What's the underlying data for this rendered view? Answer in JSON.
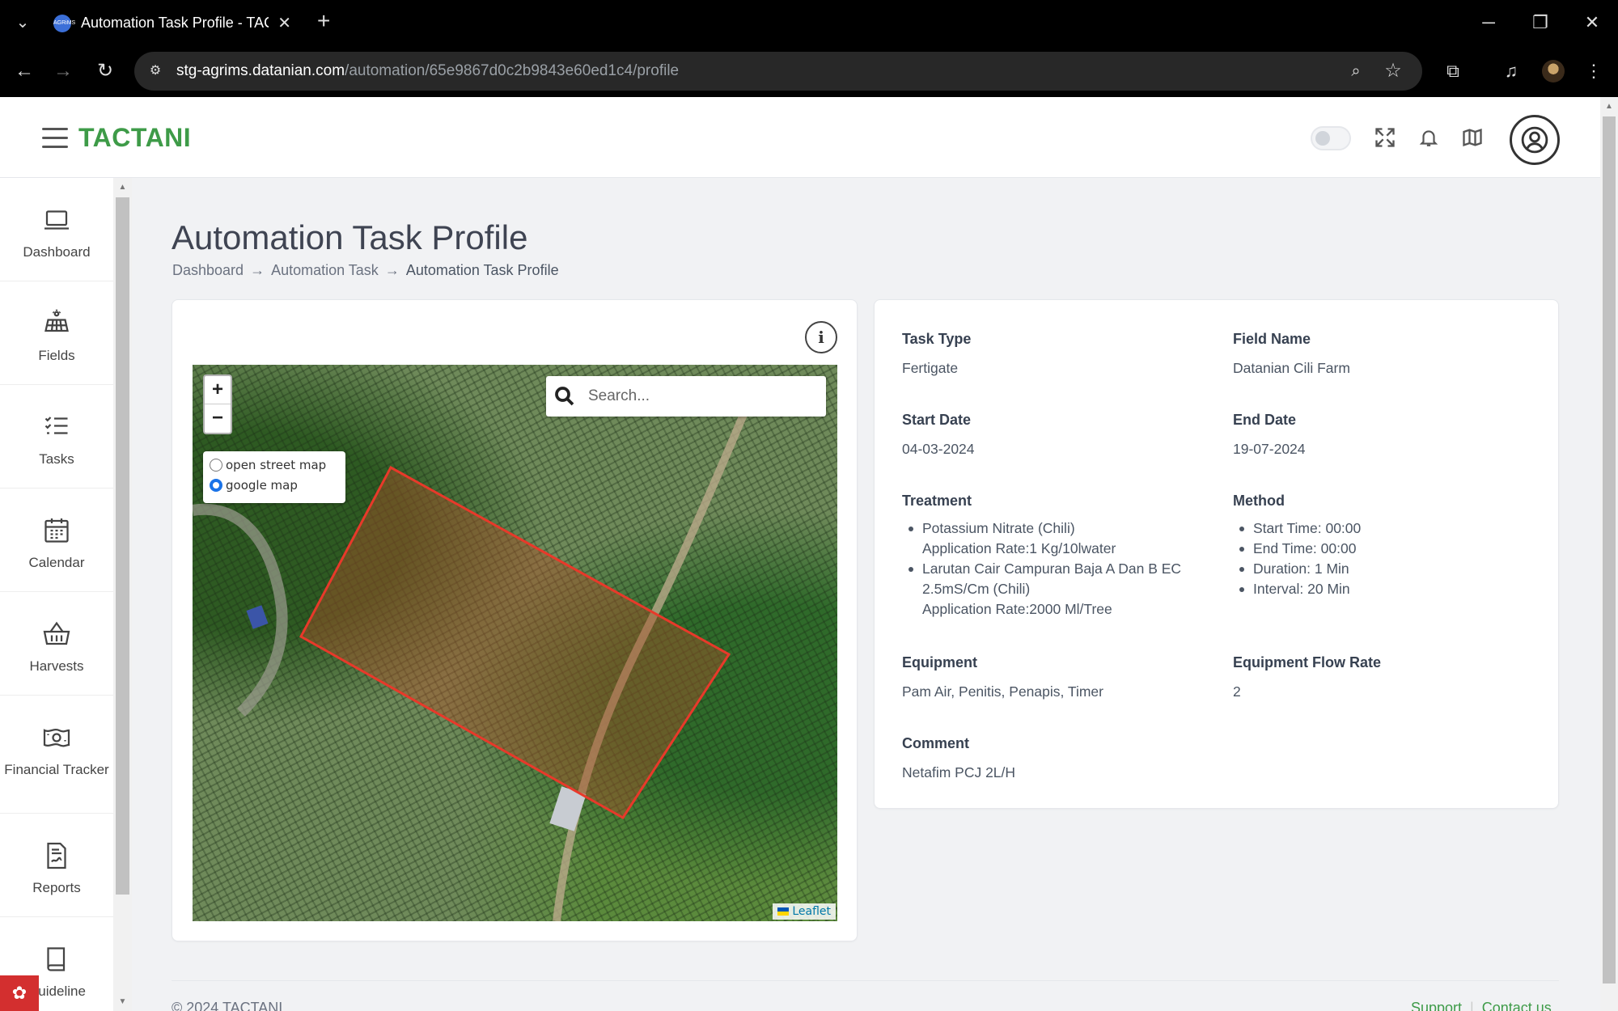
{
  "browser": {
    "tab_title": "Automation Task Profile - TACTANI",
    "favicon_text": "AGRiMS",
    "url_host": "stg-agrims.datanian.com",
    "url_path": "/automation/65e9867d0c2b9843e60ed1c4/profile"
  },
  "header": {
    "brand": "TACTANI",
    "dark_mode_on": false
  },
  "sidebar": {
    "items": [
      {
        "label": "Dashboard",
        "icon": "laptop-icon"
      },
      {
        "label": "Fields",
        "icon": "solar-panel-icon"
      },
      {
        "label": "Tasks",
        "icon": "task-list-icon"
      },
      {
        "label": "Calendar",
        "icon": "calendar-icon"
      },
      {
        "label": "Harvests",
        "icon": "basket-icon"
      },
      {
        "label": "Financial Tracker",
        "icon": "money-icon"
      },
      {
        "label": "Reports",
        "icon": "report-icon"
      },
      {
        "label": "Guideline",
        "icon": "book-icon"
      }
    ]
  },
  "page": {
    "title": "Automation Task Profile",
    "breadcrumb": [
      "Dashboard",
      "Automation Task",
      "Automation Task Profile"
    ]
  },
  "map": {
    "zoom_in": "+",
    "zoom_out": "−",
    "layers": [
      "open street map",
      "google map"
    ],
    "selected_layer": "google map",
    "search_placeholder": "Search...",
    "attribution": "Leaflet",
    "field_outline_color": "#e8392a"
  },
  "details": {
    "task_type_label": "Task Type",
    "task_type": "Fertigate",
    "field_name_label": "Field Name",
    "field_name": "Datanian Cili Farm",
    "start_date_label": "Start Date",
    "start_date": "04-03-2024",
    "end_date_label": "End Date",
    "end_date": "19-07-2024",
    "treatment_label": "Treatment",
    "treatment": [
      {
        "line1": "Potassium Nitrate (Chili)",
        "line2": "Application Rate:1 Kg/10lwater"
      },
      {
        "line1": "Larutan Cair Campuran Baja A Dan B EC",
        "line2": "2.5mS/Cm (Chili)",
        "line3": "Application Rate:2000 Ml/Tree"
      }
    ],
    "method_label": "Method",
    "method": [
      "Start Time: 00:00",
      "End Time: 00:00",
      "Duration: 1 Min",
      "Interval: 20 Min"
    ],
    "equipment_label": "Equipment",
    "equipment": "Pam Air, Penitis, Penapis, Timer",
    "flow_rate_label": "Equipment Flow Rate",
    "flow_rate": "2",
    "comment_label": "Comment",
    "comment": "Netafim PCJ 2L/H"
  },
  "footer": {
    "copyright": "© 2024 TACTANI",
    "support": "Support",
    "contact": "Contact us"
  },
  "colors": {
    "brand_green": "#3e9b48",
    "page_bg": "#f1f2f4"
  }
}
